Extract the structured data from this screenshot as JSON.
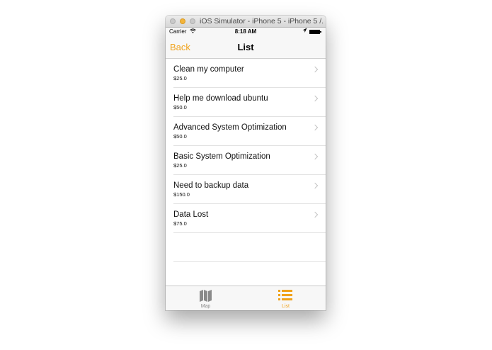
{
  "window": {
    "title": "iOS Simulator - iPhone 5 - iPhone 5 /..."
  },
  "status": {
    "carrier": "Carrier",
    "time": "8:18 AM"
  },
  "navbar": {
    "back_label": "Back",
    "title": "List"
  },
  "list": {
    "items": [
      {
        "title": "Clean my computer",
        "price": "$25.0"
      },
      {
        "title": "Help me download ubuntu",
        "price": "$50.0"
      },
      {
        "title": "Advanced System Optimization",
        "price": "$50.0"
      },
      {
        "title": "Basic System Optimization",
        "price": "$25.0"
      },
      {
        "title": "Need to backup data",
        "price": "$150.0"
      },
      {
        "title": "Data Lost",
        "price": "$75.0"
      }
    ]
  },
  "tabbar": {
    "tabs": [
      {
        "label": "Map",
        "icon": "map-icon",
        "selected": false
      },
      {
        "label": "List",
        "icon": "list-icon",
        "selected": true
      }
    ]
  },
  "colors": {
    "accent": "#f0a21b",
    "inactive_tab": "#8a8a8a"
  }
}
